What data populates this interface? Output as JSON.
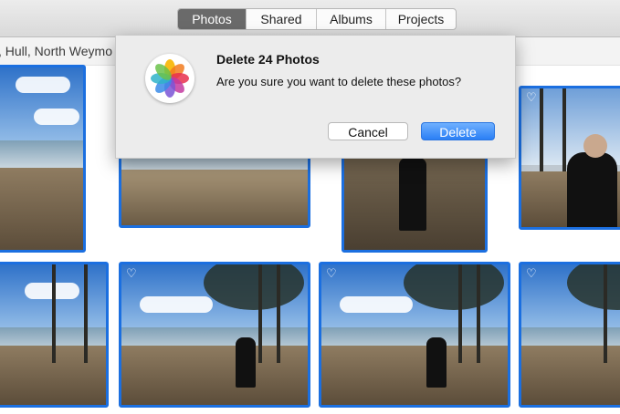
{
  "toolbar": {
    "tabs": [
      "Photos",
      "Shared",
      "Albums",
      "Projects"
    ],
    "active_tab": "Photos"
  },
  "location_text": ", Hull, North Weymo",
  "dialog": {
    "title": "Delete 24 Photos",
    "message": "Are you sure you want to delete these photos?",
    "cancel_label": "Cancel",
    "delete_label": "Delete"
  },
  "colors": {
    "selection": "#1b6fe0",
    "delete_button": "#2a7ff5"
  },
  "icons": [
    "photos-app-icon",
    "heart-icon"
  ],
  "selected_photo_count": 24
}
